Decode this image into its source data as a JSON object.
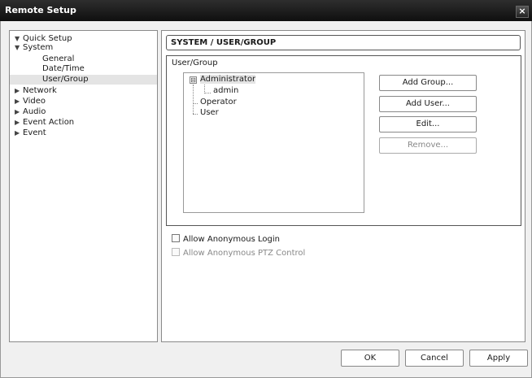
{
  "window": {
    "title": "Remote Setup",
    "close_icon": "×"
  },
  "tree": {
    "items": [
      {
        "label": "Quick Setup",
        "arrow": "▼"
      },
      {
        "label": "System",
        "arrow": "▼"
      },
      {
        "label": "General",
        "arrow": ""
      },
      {
        "label": "Date/Time",
        "arrow": ""
      },
      {
        "label": "User/Group",
        "arrow": "",
        "selected": true
      },
      {
        "label": "Network",
        "arrow": "▶"
      },
      {
        "label": "Video",
        "arrow": "▶"
      },
      {
        "label": "Audio",
        "arrow": "▶"
      },
      {
        "label": "Event Action",
        "arrow": "▶"
      },
      {
        "label": "Event",
        "arrow": "▶"
      }
    ]
  },
  "panel": {
    "header": "SYSTEM / USER/GROUP",
    "group_label": "User/Group",
    "user_tree": {
      "expand_icon": "⊟",
      "nodes": [
        {
          "label": "Administrator"
        },
        {
          "label": "admin"
        },
        {
          "label": "Operator"
        },
        {
          "label": "User"
        }
      ]
    },
    "buttons": {
      "add_group": "Add Group...",
      "add_user": "Add User...",
      "edit": "Edit...",
      "remove": "Remove..."
    },
    "options": {
      "anonymous_login": "Allow Anonymous Login",
      "anonymous_ptz": "Allow Anonymous PTZ Control"
    }
  },
  "footer": {
    "ok": "OK",
    "cancel": "Cancel",
    "apply": "Apply"
  }
}
